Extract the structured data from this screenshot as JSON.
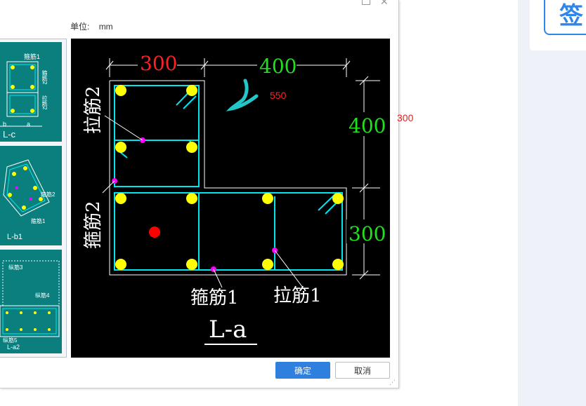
{
  "dialog": {
    "unit_label": "单位:",
    "unit_value": "mm",
    "ok_label": "确定",
    "cancel_label": "取消"
  },
  "thumbnails": [
    {
      "name": "L-c",
      "label": "L-c",
      "sub_labels": [
        "箍筋1",
        "箍筋2",
        "拉筋2",
        "b",
        "a"
      ]
    },
    {
      "name": "L-b1",
      "label": "L-b1",
      "sub_labels": [
        "箍筋2",
        "箍筋1"
      ]
    },
    {
      "name": "L-a2",
      "label": "L-a2",
      "sub_labels": [
        "纵筋3",
        "纵筋4",
        "纵筋5"
      ]
    }
  ],
  "drawing": {
    "dim_top_left": "300",
    "dim_top_right": "400",
    "dim_right_top": "400",
    "dim_right_bottom": "300",
    "annotation_550": "550",
    "label_lajin2": "拉筋2",
    "label_gujin2": "箍筋2",
    "label_gujin1": "箍筋1",
    "label_lajin1": "拉筋1",
    "section_name": "L-a"
  },
  "outside_annotation": "300",
  "sidebar": {
    "sign_button": "签"
  },
  "colors": {
    "background": "#000000",
    "outline": "#ffffff",
    "rebar": "#00e5ee",
    "bar_dot": "#ffff00",
    "marker": "#ff00ff",
    "red_text": "#ff2020",
    "green_text": "#20e020",
    "accent": "#2f7fde"
  }
}
